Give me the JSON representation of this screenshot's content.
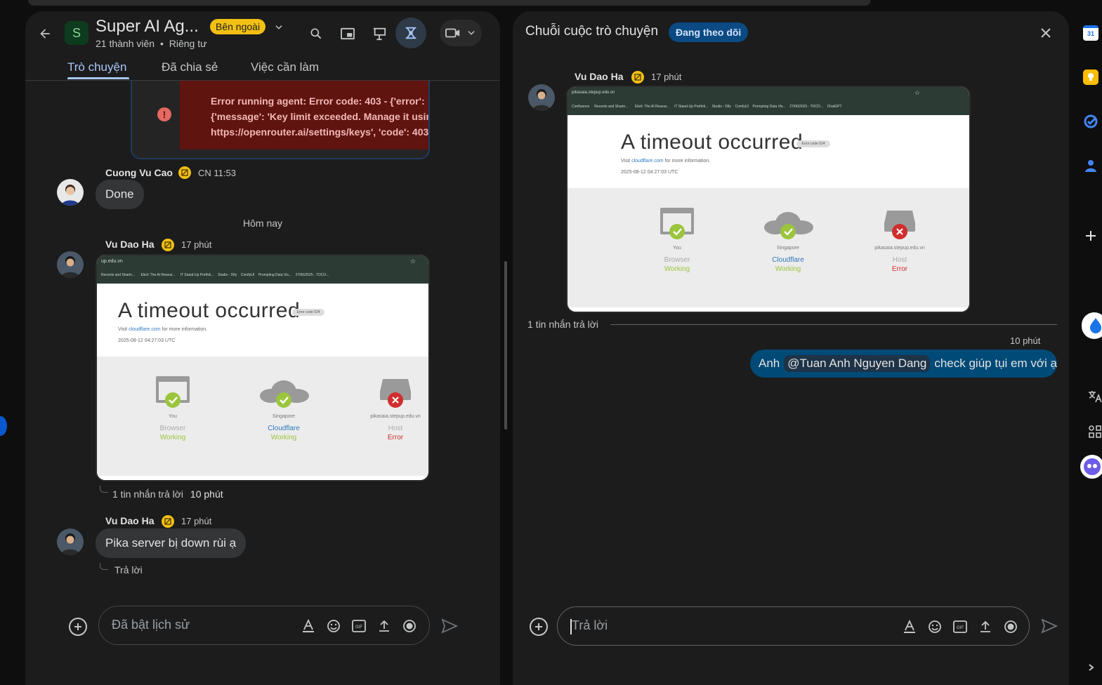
{
  "space": {
    "initial": "S",
    "title": "Super AI Ag...",
    "external_badge": "Bên ngoài",
    "members": "21 thành viên",
    "separator": "•",
    "privacy": "Riêng tư"
  },
  "tabs": [
    {
      "label": "Trò chuyện",
      "active": true
    },
    {
      "label": "Đã chia sẻ",
      "active": false
    },
    {
      "label": "Việc cần làm",
      "active": false
    }
  ],
  "error_card": {
    "line1": "Error running agent: Error code: 403 - {'error':",
    "line2": "{'message': 'Key limit exceeded. Manage it usin",
    "line3": "https://openrouter.ai/settings/keys', 'code': 403"
  },
  "messages": [
    {
      "author": "Cuong Vu Cao",
      "time": "CN 11:53",
      "text": "Done"
    },
    {
      "author": "Vu Dao Ha",
      "time": "17 phút",
      "replies": "1 tin nhắn trả lời",
      "reply_time": "10 phút"
    },
    {
      "author": "Vu Dao Ha",
      "time": "17 phút",
      "text": "Pika server bị down rùi ạ",
      "reply_label": "Trả lời"
    }
  ],
  "day_divider": "Hôm nay",
  "screenshot_img": {
    "url": "pikasaia.stepup.edu.vn",
    "url_partial": "up.edu.vn",
    "bookmarks": [
      "Confluence",
      "Recents and Sharin...",
      "Elicit: The AI Resear...",
      "IT Stand-Up Portfoli...",
      "Studio - Dify",
      "ComfyUI",
      "Prompting Data Vis...",
      "27/06/2025 - TOCO...",
      "ChatGPT"
    ],
    "title": "A timeout occurred",
    "error_code": "Error code 524",
    "visit_prefix": "Visit",
    "visit_link": "cloudflare.com",
    "visit_suffix": "for more information.",
    "timestamp": "2025-08-12 04:27:03 UTC",
    "columns": [
      {
        "location": "You",
        "name": "Browser",
        "status": "Working",
        "ok": true
      },
      {
        "location": "Singapore",
        "name": "Cloudflare",
        "status": "Working",
        "ok": true
      },
      {
        "location": "pikasaia.stepup.edu.vn",
        "name": "Host",
        "status": "Error",
        "ok": false
      }
    ]
  },
  "compose": {
    "placeholder": "Đã bật lịch sử"
  },
  "thread": {
    "title": "Chuỗi cuộc trò chuyện",
    "follow_badge": "Đang theo dõi",
    "author": "Vu Dao Ha",
    "time": "17 phút",
    "reply_count": "1 tin nhắn trả lời",
    "reply_time": "10 phút",
    "reply_prefix": "Anh",
    "mention": "@Tuan Anh Nguyen Dang",
    "reply_suffix": "check giúp tụi em với ạ",
    "compose_placeholder": "Trả lời"
  },
  "sidebar": {
    "calendar_day": "31"
  },
  "colors": {
    "panel": "#1c1c1c",
    "accent_blue": "#a8c7fa",
    "my_bubble": "#004a77",
    "badge_yellow": "#f2c014",
    "error_bg": "#601410",
    "error_text": "#f2b8b5"
  }
}
